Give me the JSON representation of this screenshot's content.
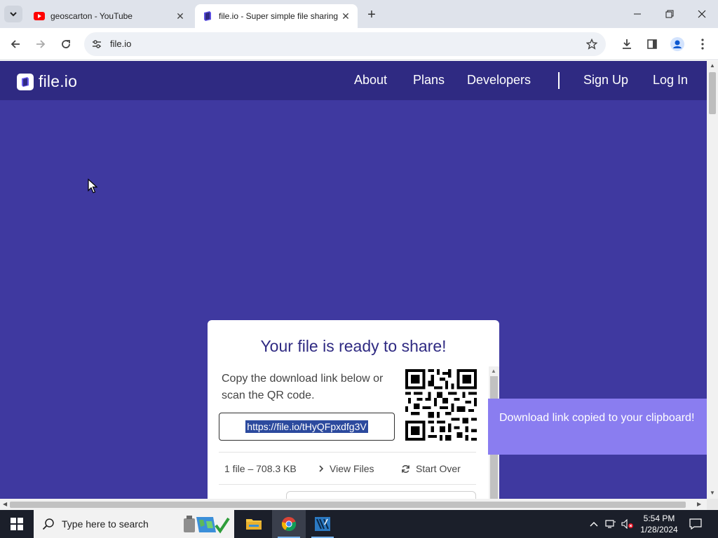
{
  "browser": {
    "tabs": [
      {
        "title": "geoscarton - YouTube",
        "favicon": "youtube-icon",
        "active": false
      },
      {
        "title": "file.io - Super simple file sharing",
        "favicon": "fileio-icon",
        "active": true
      }
    ],
    "address": "file.io"
  },
  "site": {
    "logo_text": "file.io",
    "nav": {
      "about": "About",
      "plans": "Plans",
      "developers": "Developers",
      "signup": "Sign Up",
      "login": "Log In"
    }
  },
  "card": {
    "title": "Your file is ready to share!",
    "instructions": "Copy the download link below or scan the QR code.",
    "link": "https://file.io/tHyQFpxdfg3V",
    "file_info": "1 file – 708.3 KB",
    "view_files": "View Files",
    "start_over": "Start Over"
  },
  "toast": {
    "message": "Download link copied to your clipboard!"
  },
  "taskbar": {
    "search_placeholder": "Type here to search",
    "time": "5:54 PM",
    "date": "1/28/2024"
  },
  "colors": {
    "page_bg": "#3f39a0",
    "nav_bg": "#2f2a82",
    "toast_bg": "#8a7df0",
    "title_color": "#2f2a82"
  }
}
